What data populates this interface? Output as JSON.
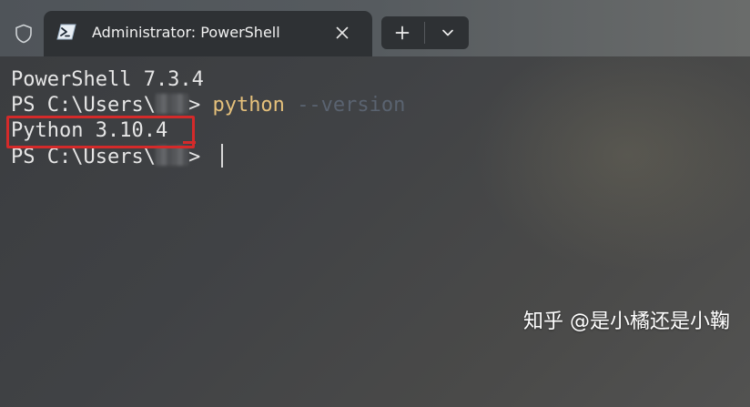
{
  "titlebar": {
    "shield_icon": "shield-icon",
    "tab": {
      "icon": "powershell-icon",
      "title": "Administrator: PowerShell",
      "close_glyph": "✕"
    },
    "new_tab_glyph": "+",
    "dropdown_glyph": "⌄"
  },
  "terminal": {
    "line1": "PowerShell 7.3.4",
    "prompt_prefix": "PS C:\\Users\\",
    "prompt_suffix": "> ",
    "command": "python",
    "parameter": "--version",
    "output": "Python 3.10.4",
    "highlight_color": "#d42a2a"
  },
  "watermark": "知乎 @是小橘还是小鞠"
}
